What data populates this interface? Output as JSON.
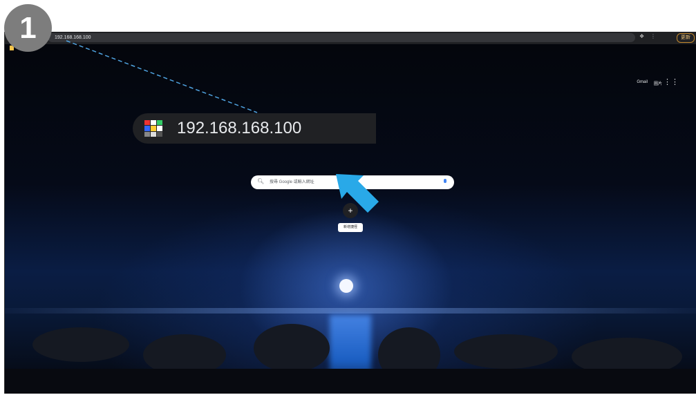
{
  "toolbar": {
    "url": "192.168.168.100",
    "update_label": "更新",
    "menu_icon": "kebab-menu-icon"
  },
  "newtab": {
    "gmail_label": "Gmail",
    "images_label": "圖片",
    "apps_icon": "apps-grid-icon",
    "search_placeholder": "搜尋 Google 或輸入網址",
    "shortcut_label": "新增捷徑",
    "shortcut_icon": "plus-icon"
  },
  "annotation": {
    "step_number": "1",
    "zoomed_url": "192.168.168.100",
    "leader_color": "#4fa3e0",
    "arrow_color": "#29a9e8"
  }
}
